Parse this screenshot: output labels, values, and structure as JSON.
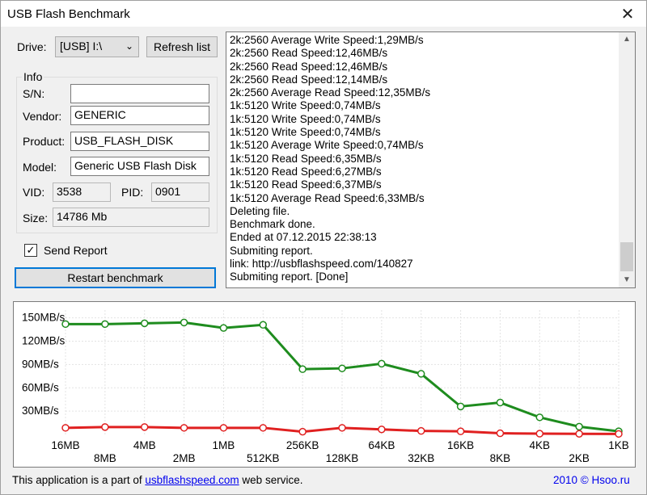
{
  "window": {
    "title": "USB Flash Benchmark",
    "close_glyph": "✕"
  },
  "drive": {
    "label": "Drive:",
    "value": "[USB] I:\\",
    "refresh_label": "Refresh list"
  },
  "info": {
    "group_label": "Info",
    "sn_label": "S/N:",
    "sn_value": "",
    "vendor_label": "Vendor:",
    "vendor_value": "GENERIC",
    "product_label": "Product:",
    "product_value": "USB_FLASH_DISK",
    "model_label": "Model:",
    "model_value": "Generic USB Flash Disk",
    "vid_label": "VID:",
    "vid_value": "3538",
    "pid_label": "PID:",
    "pid_value": "0901",
    "size_label": "Size:",
    "size_value": "14786 Mb"
  },
  "send_report": {
    "label": "Send Report",
    "checked": true,
    "check_glyph": "✓"
  },
  "restart_label": "Restart benchmark",
  "log": [
    "2k:2560 Average Write Speed:1,29MB/s",
    "2k:2560 Read Speed:12,46MB/s",
    "2k:2560 Read Speed:12,46MB/s",
    "2k:2560 Read Speed:12,14MB/s",
    "2k:2560 Average Read Speed:12,35MB/s",
    "1k:5120 Write Speed:0,74MB/s",
    "1k:5120 Write Speed:0,74MB/s",
    "1k:5120 Write Speed:0,74MB/s",
    "1k:5120 Average Write Speed:0,74MB/s",
    "1k:5120 Read Speed:6,35MB/s",
    "1k:5120 Read Speed:6,27MB/s",
    "1k:5120 Read Speed:6,37MB/s",
    "1k:5120 Average Read Speed:6,33MB/s",
    "Deleting file.",
    "Benchmark done.",
    "Ended at 07.12.2015 22:38:13",
    "Submiting report.",
    "link: http://usbflashspeed.com/140827",
    "Submiting report. [Done]"
  ],
  "scrollbar": {
    "up_glyph": "▲",
    "down_glyph": "▼"
  },
  "chart_data": {
    "type": "line",
    "categories": [
      "16MB",
      "8MB",
      "4MB",
      "2MB",
      "1MB",
      "512KB",
      "256KB",
      "128KB",
      "64KB",
      "32KB",
      "16KB",
      "8KB",
      "4KB",
      "2KB",
      "1KB"
    ],
    "y_tick_labels": [
      "150MB/s",
      "120MB/s",
      "90MB/s",
      "60MB/s",
      "30MB/s"
    ],
    "y_ticks": [
      150,
      120,
      90,
      60,
      30
    ],
    "ylim": [
      0,
      160
    ],
    "grid": true,
    "series": [
      {
        "color": "#1e8c1e",
        "values": [
          142,
          142,
          143,
          144,
          137,
          141,
          84,
          85,
          91,
          78,
          36,
          41,
          22,
          10,
          4
        ]
      },
      {
        "color": "#e02020",
        "values": [
          8.5,
          9.5,
          9.5,
          8.5,
          8.5,
          8.5,
          3.5,
          8.5,
          6.5,
          4.5,
          4,
          1.5,
          1,
          0.8,
          0.7
        ]
      }
    ]
  },
  "footer": {
    "prefix": "This application is a part of ",
    "link": "usbflashspeed.com",
    "suffix": " web service."
  },
  "copyright": "2010 © Hsoo.ru"
}
